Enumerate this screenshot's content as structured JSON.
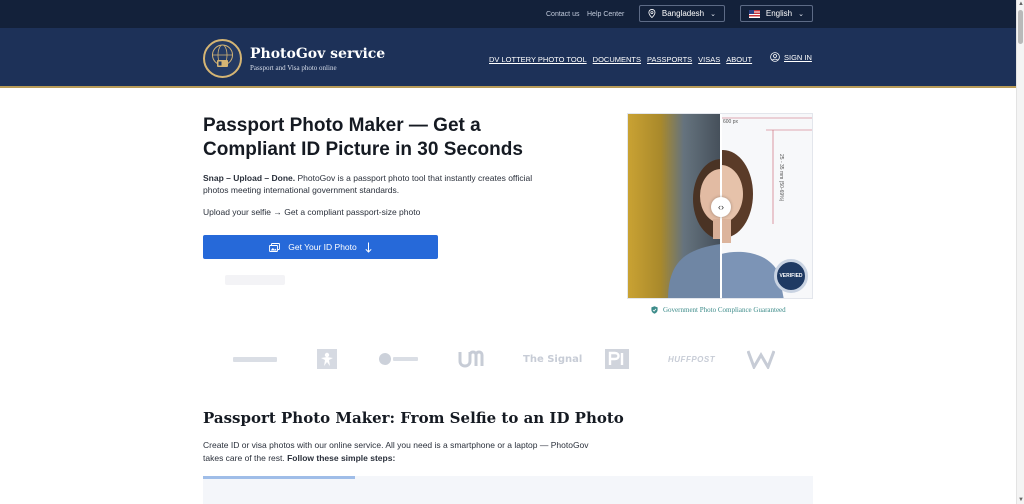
{
  "topbar": {
    "contact_label": "Contact us",
    "help_label": "Help Center",
    "country": "Bangladesh",
    "language": "English"
  },
  "brand": {
    "name": "PhotoGov service",
    "tagline": "Passport and Visa photo online"
  },
  "nav": {
    "items": [
      "DV LOTTERY PHOTO TOOL",
      "DOCUMENTS",
      "PASSPORTS",
      "VISAS",
      "ABOUT"
    ],
    "sign_in": "SIGN IN"
  },
  "hero": {
    "title_bold": "Passport Photo Maker",
    "title_rest": " — Get a Compliant ID Picture in 30 Seconds",
    "desc_bold": "Snap – Upload – Done.",
    "desc_rest": " PhotoGov is a passport photo tool that instantly creates official photos meeting international government standards.",
    "steps": "Upload your selfie → Get a compliant passport-size photo",
    "cta_label": "Get Your ID Photo"
  },
  "comparison": {
    "width_label": "600 px",
    "height_label": "25 - 35 mm (50-69%)",
    "badge": "VERIFIED",
    "guarantee": "Government Photo Compliance Guaranteed"
  },
  "press": [
    "The Signal",
    "HUFFPOST"
  ],
  "section": {
    "title": "Passport Photo Maker: From Selfie to an ID Photo",
    "desc_rest": "Create ID or visa photos with our online service. All you need is a smartphone or a laptop — PhotoGov takes care of the rest. ",
    "desc_bold": "Follow these simple steps:"
  },
  "colors": {
    "topbar_bg": "#13213a",
    "header_bg": "#1d3158",
    "accent_gold": "#b89b57",
    "cta_blue": "#2669d9",
    "guarantee_teal": "#3d8c8a"
  }
}
